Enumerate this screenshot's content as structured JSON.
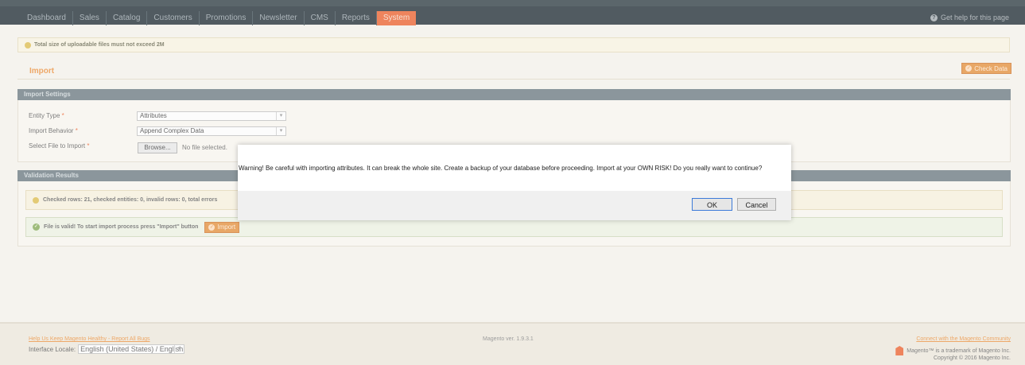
{
  "nav": {
    "items": [
      "Dashboard",
      "Sales",
      "Catalog",
      "Customers",
      "Promotions",
      "Newsletter",
      "CMS",
      "Reports",
      "System"
    ],
    "active": "System",
    "help": "Get help for this page"
  },
  "notice": "Total size of uploadable files must not exceed 2M",
  "page": {
    "title": "Import",
    "check_data_button": "Check Data"
  },
  "import_settings": {
    "header": "Import Settings",
    "entity_type_label": "Entity Type",
    "entity_type_value": "Attributes",
    "import_behavior_label": "Import Behavior",
    "import_behavior_value": "Append Complex Data",
    "select_file_label": "Select File to Import",
    "browse_button": "Browse...",
    "no_file_text": "No file selected."
  },
  "validation": {
    "header": "Validation Results",
    "warning_message": "Checked rows: 21, checked entities: 0, invalid rows: 0, total errors",
    "success_message": "File is valid! To start import process press \"Import\" button",
    "import_button": "Import"
  },
  "footer": {
    "report_bugs_link": "Help Us Keep Magento Healthy - Report All Bugs",
    "interface_locale_label": "Interface Locale:",
    "interface_locale_value": "English (United States) / English",
    "version": "Magento ver. 1.9.3.1",
    "community_link": "Connect with the Magento Community",
    "trademark": "Magento™ is a trademark of Magento Inc.",
    "copyright": "Copyright © 2016 Magento Inc."
  },
  "dialog": {
    "message": "Warning! Be careful with importing attributes. It can break the whole site. Create a backup of your database before proceeding. Import at your OWN RISK! Do you really want to continue?",
    "ok_button": "OK",
    "cancel_button": "Cancel"
  }
}
